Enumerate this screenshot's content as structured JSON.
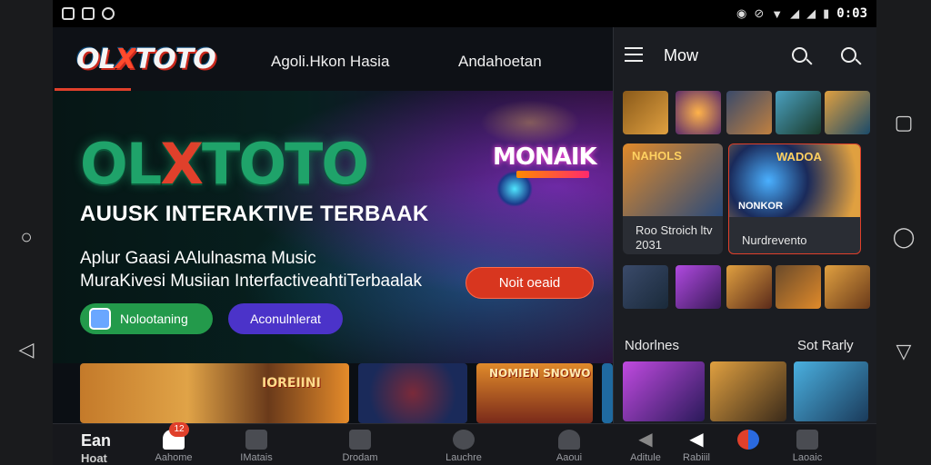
{
  "status_bar": {
    "time": "0:03"
  },
  "header": {
    "logo": "OLXTOTO",
    "nav": [
      "Agoli.Hkon Hasia",
      "Andahoetan"
    ]
  },
  "hero": {
    "title_part1": "OL",
    "title_x": "X",
    "title_part2": "TOTO",
    "subtitle": "AUUSK INTERAKTIVE TERBAAK",
    "description_line1": "Aplur Gaasi AAlulnasma Music",
    "description_line2": "MuraKivesi Musiian InterfactiveahtiTerbaalak",
    "promo_title": "MONAIK",
    "cta_label": "Noit oeaid",
    "pill_green_label": "Nolootaning",
    "pill_purple_label": "Aconulnlerat"
  },
  "banners": [
    {
      "label": ""
    },
    {
      "label": "IOREIINI"
    },
    {
      "label": ""
    },
    {
      "label": "NOMIEN SNOWO"
    },
    {
      "label": ""
    }
  ],
  "panel": {
    "title": "Mow",
    "cards": [
      {
        "caption_line1": "Roo Stroich ltv",
        "caption_line2": "2031"
      },
      {
        "caption_line1": "Nurdrevento",
        "caption_line2": ""
      }
    ],
    "card_art_labels": [
      "NAHOLS",
      "WADOA",
      "NONKOR"
    ],
    "section_left": "Ndorlnes",
    "section_right": "Sot Rarly"
  },
  "bottom_nav": {
    "earn_label": "Ean",
    "badge": "12",
    "items": [
      "Hoat",
      "Aahome",
      "IMatais",
      "Drodam",
      "Lauchre",
      "Aaoui",
      "Aditule",
      "Rabiiil",
      "",
      "Laoaic"
    ]
  },
  "colors": {
    "accent_red": "#e0402b",
    "brand_green": "#1fa36a",
    "purple": "#4b33c9",
    "pill_green": "#239a4b"
  }
}
